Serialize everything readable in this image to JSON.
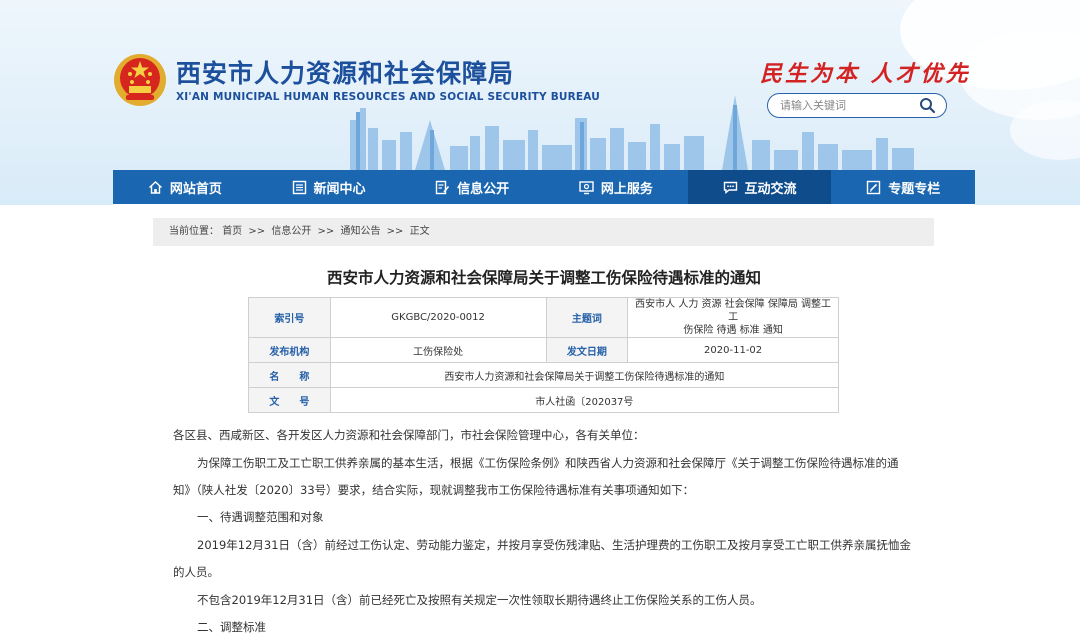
{
  "header": {
    "site_title": "西安市人力资源和社会保障局",
    "site_subtitle": "XI'AN MUNICIPAL HUMAN RESOURCES AND SOCIAL SECURITY BUREAU",
    "slogan": "民生为本 人才优先",
    "search_placeholder": "请输入关键词",
    "colors": {
      "brand_blue": "#1c4f9c",
      "slogan_red": "#d22222"
    }
  },
  "nav": {
    "items": [
      {
        "label": "网站首页",
        "icon": "home-icon"
      },
      {
        "label": "新闻中心",
        "icon": "news-icon"
      },
      {
        "label": "信息公开",
        "icon": "info-edit-icon"
      },
      {
        "label": "网上服务",
        "icon": "monitor-icon"
      },
      {
        "label": "互动交流",
        "icon": "chat-icon",
        "active": true
      },
      {
        "label": "专题专栏",
        "icon": "topic-icon"
      }
    ],
    "colors": {
      "bar": "#1a66b0",
      "active": "#0f4c8c"
    }
  },
  "breadcrumb": {
    "prefix": "当前位置：",
    "items": [
      "首页",
      "信息公开",
      "通知公告",
      "正文"
    ],
    "separator": ">>"
  },
  "document": {
    "title": "西安市人力资源和社会保障局关于调整工伤保险待遇标准的通知",
    "meta": {
      "index_label": "索引号",
      "index_value": "GKGBC/2020-0012",
      "subject_label": "主题词",
      "subject_value_line1": "西安市人 人力 资源 社会保障 保障局 调整工 工",
      "subject_value_line2": "伤保险 待遇 标准 通知",
      "issuer_label": "发布机构",
      "issuer_value": "工伤保险处",
      "date_label": "发文日期",
      "date_value": "2020-11-02",
      "name_label": "名　　称",
      "name_value": "西安市人力资源和社会保障局关于调整工伤保险待遇标准的通知",
      "docno_label": "文　　号",
      "docno_value": "市人社函〔202037号"
    },
    "paragraphs": [
      "各区县、西咸新区、各开发区人力资源和社会保障部门，市社会保险管理中心，各有关单位：",
      "为保障工伤职工及工亡职工供养亲属的基本生活，根据《工伤保险条例》和陕西省人力资源和社会保障厅《关于调整工伤保险待遇标准的通",
      "知》（陕人社发〔2020〕33号）要求，结合实际，现就调整我市工伤保险待遇标准有关事项通知如下：",
      "一、待遇调整范围和对象",
      "2019年12月31日（含）前经过工伤认定、劳动能力鉴定，并按月享受伤残津贴、生活护理费的工伤职工及按月享受工亡职工供养亲属抚恤金",
      "的人员。",
      "不包含2019年12月31日（含）前已经死亡及按照有关规定一次性领取长期待遇终止工伤保险关系的工伤人员。",
      "二、调整标准"
    ]
  }
}
